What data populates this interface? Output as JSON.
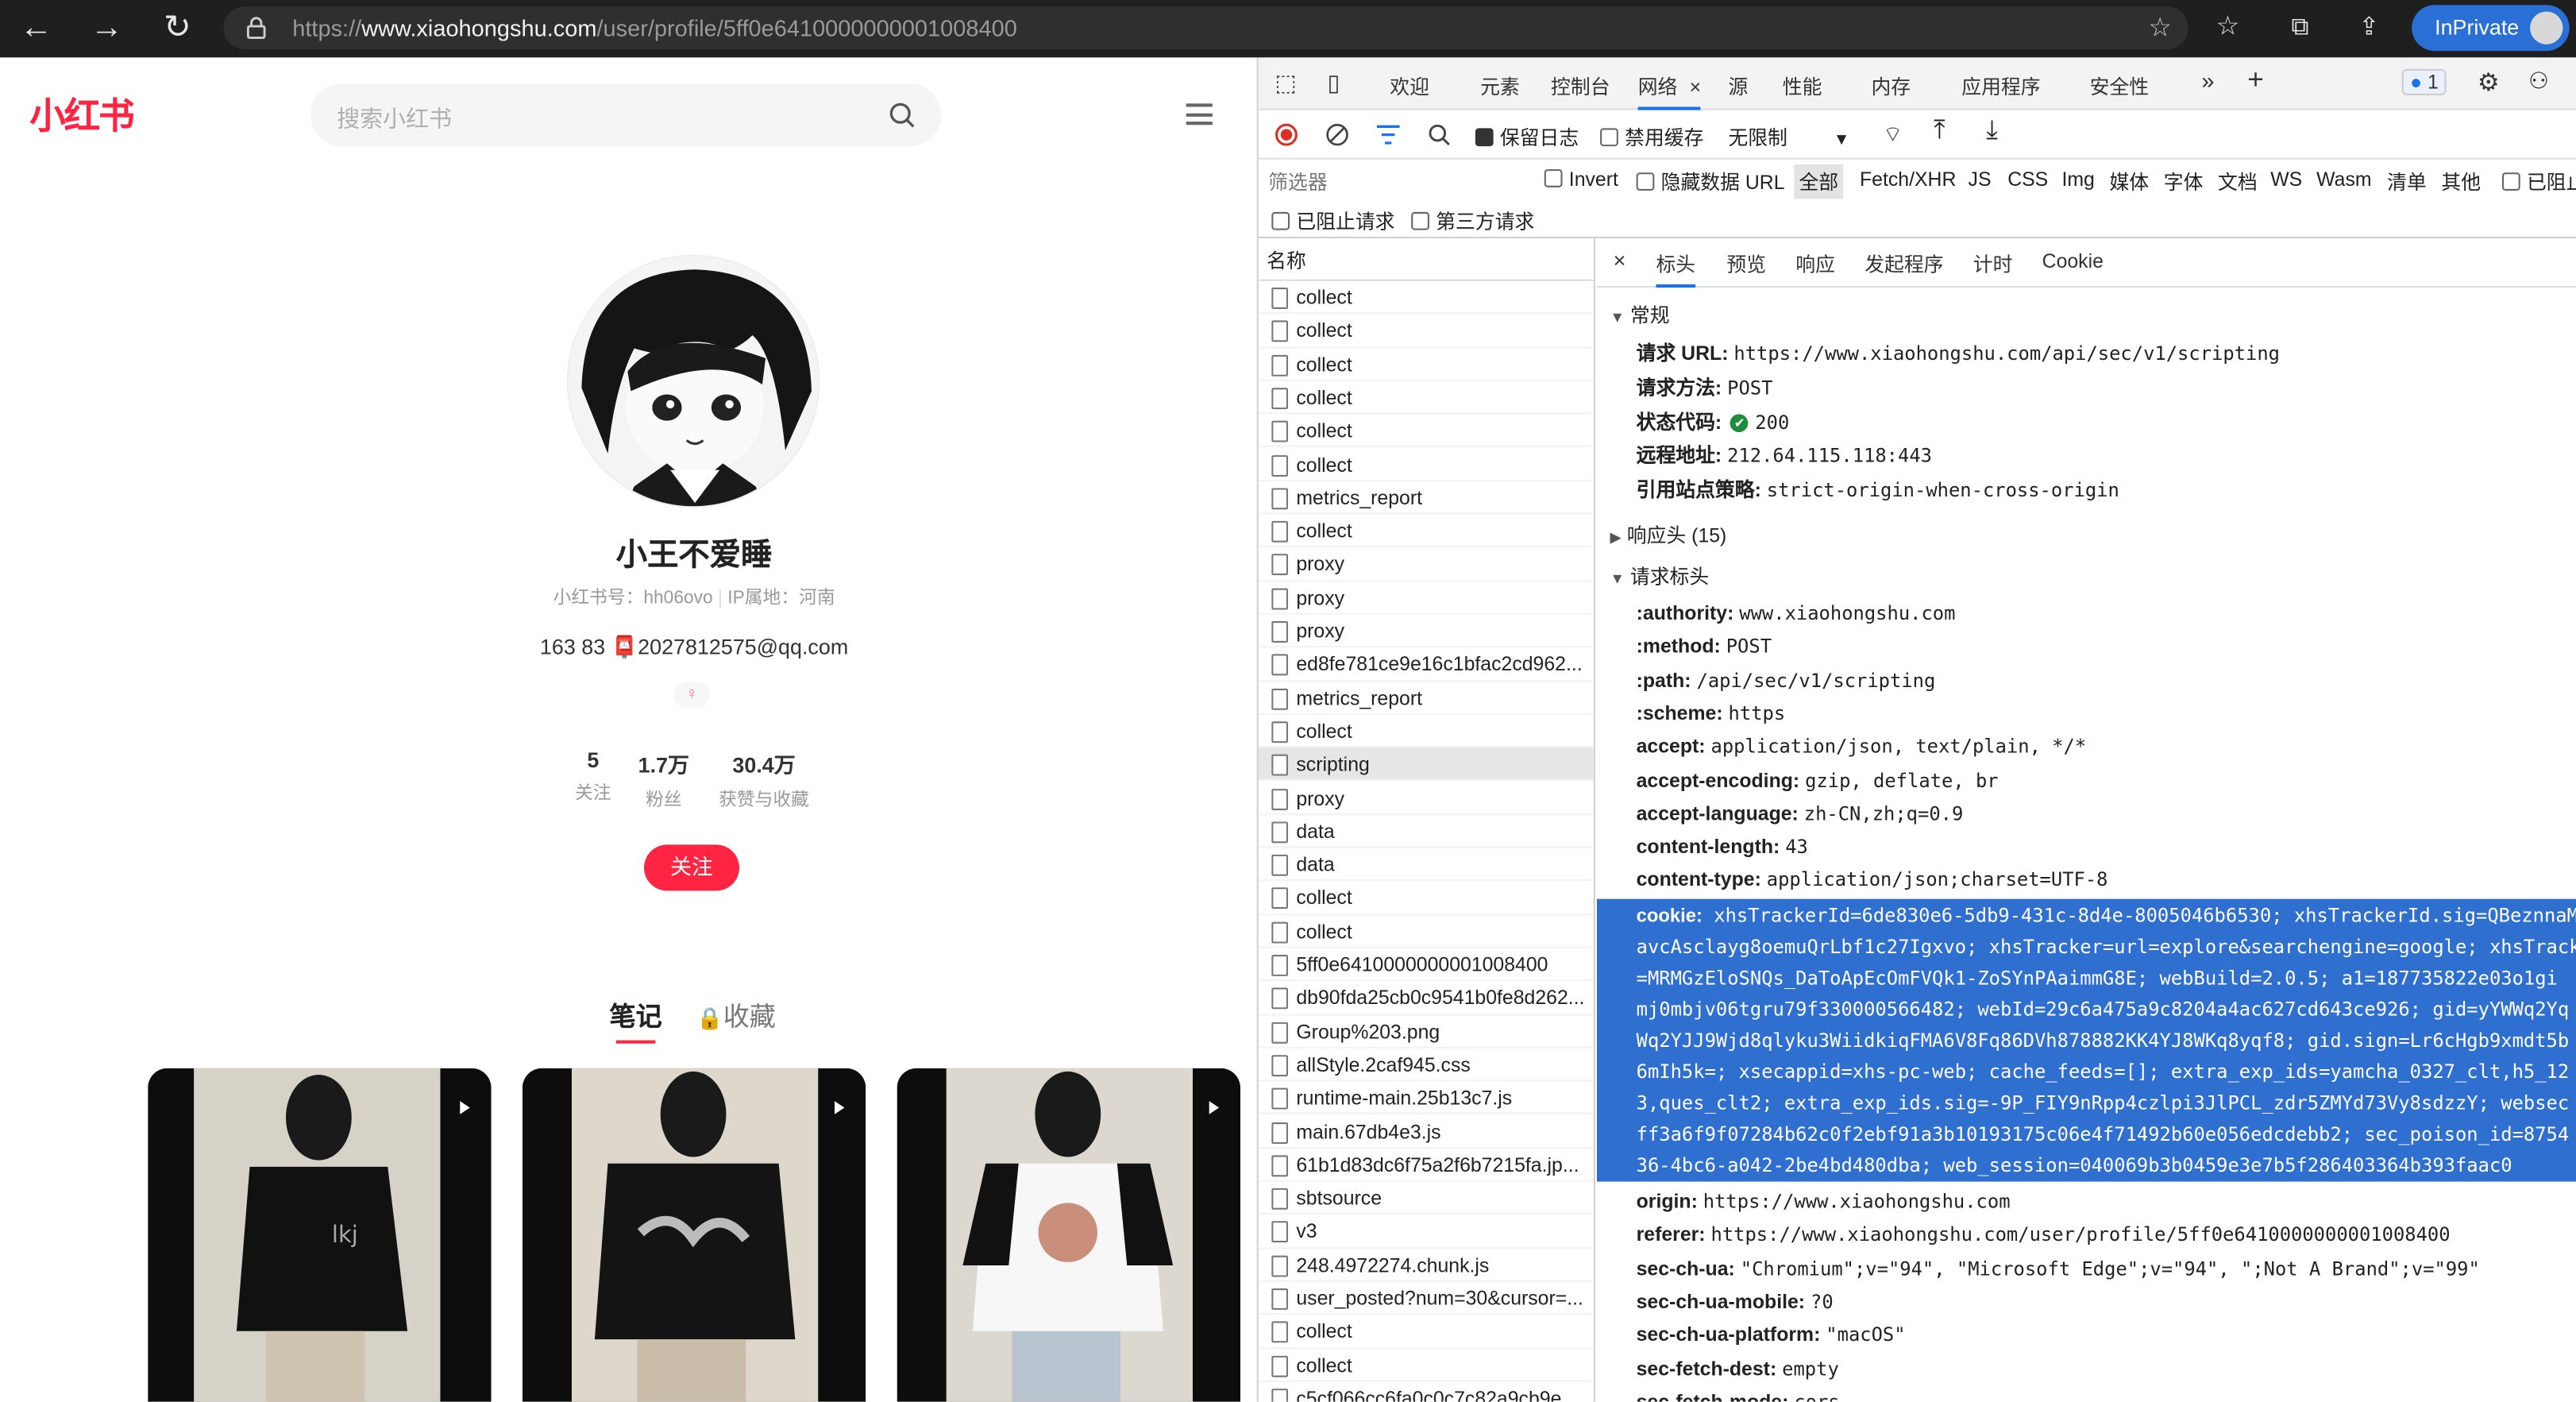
{
  "browser": {
    "url_prefix": "https://",
    "url_host": "www.xiaohongshu.com",
    "url_path": "/user/profile/5ff0e6410000000001008400",
    "inprivate_label": "InPrivate"
  },
  "site": {
    "logo": "小红书",
    "search_placeholder": "搜索小红书"
  },
  "profile": {
    "name": "小王不爱睡",
    "id_line": "小红书号：hh06ovo",
    "ip_line": "IP属地：河南",
    "bio_prefix": "163 83 ",
    "bio_email": "2027812575@qq.com",
    "gender_symbol": "♀",
    "stats": [
      {
        "value": "5",
        "label": "关注"
      },
      {
        "value": "1.7万",
        "label": "粉丝"
      },
      {
        "value": "30.4万",
        "label": "获赞与收藏"
      }
    ],
    "follow_label": "关注",
    "tabs": [
      "笔记",
      "收藏"
    ]
  },
  "devtools": {
    "tabs": [
      "欢迎",
      "元素",
      "控制台",
      "网络",
      "源",
      "性能",
      "内存",
      "应用程序",
      "安全性"
    ],
    "issue_count": "1",
    "toolbar": {
      "preserve_log": "保留日志",
      "disable_cache": "禁用缓存",
      "throttle": "无限制"
    },
    "filter": {
      "placeholder": "筛选器",
      "invert": "Invert",
      "hide_data_urls": "隐藏数据 URL",
      "types": [
        "全部",
        "Fetch/XHR",
        "JS",
        "CSS",
        "Img",
        "媒体",
        "字体",
        "文档",
        "WS",
        "Wasm",
        "清单",
        "其他"
      ],
      "blocked_cookies": "已阻止",
      "blocked_requests": "已阻止请求",
      "third_party": "第三方请求"
    },
    "list_header": "名称",
    "requests": [
      "collect",
      "collect",
      "collect",
      "collect",
      "collect",
      "collect",
      "metrics_report",
      "collect",
      "proxy",
      "proxy",
      "proxy",
      "ed8fe781ce9e16c1bfac2cd962...",
      "metrics_report",
      "collect",
      "scripting",
      "proxy",
      "data",
      "data",
      "collect",
      "collect",
      "5ff0e6410000000001008400",
      "db90fda25cb0c9541b0fe8d262...",
      "Group%203.png",
      "allStyle.2caf945.css",
      "runtime-main.25b13c7.js",
      "main.67db4e3.js",
      "61b1d83dc6f75a2f6b7215fa.jp...",
      "sbtsource",
      "v3",
      "248.4972274.chunk.js",
      "user_posted?num=30&cursor=...",
      "collect",
      "collect",
      "c5cf066cc6fa0c0c7c82a9cb9e..."
    ],
    "detail_tabs": [
      "标头",
      "预览",
      "响应",
      "发起程序",
      "计时",
      "Cookie"
    ],
    "general_title": "常规",
    "general": [
      {
        "k": "请求 URL:",
        "v": "https://www.xiaohongshu.com/api/sec/v1/scripting"
      },
      {
        "k": "请求方法:",
        "v": "POST"
      },
      {
        "k": "状态代码:",
        "v": "200"
      },
      {
        "k": "远程地址:",
        "v": "212.64.115.118:443"
      },
      {
        "k": "引用站点策略:",
        "v": "strict-origin-when-cross-origin"
      }
    ],
    "response_headers_title": "响应头 (15)",
    "request_headers_title": "请求标头",
    "request_headers": [
      {
        "k": ":authority:",
        "v": "www.xiaohongshu.com"
      },
      {
        "k": ":method:",
        "v": "POST"
      },
      {
        "k": ":path:",
        "v": "/api/sec/v1/scripting"
      },
      {
        "k": ":scheme:",
        "v": "https"
      },
      {
        "k": "accept:",
        "v": "application/json, text/plain, */*"
      },
      {
        "k": "accept-encoding:",
        "v": "gzip, deflate, br"
      },
      {
        "k": "accept-language:",
        "v": "zh-CN,zh;q=0.9"
      },
      {
        "k": "content-length:",
        "v": "43"
      },
      {
        "k": "content-type:",
        "v": "application/json;charset=UTF-8"
      }
    ],
    "cookie_key": "cookie:",
    "cookie_lines": [
      "xhsTrackerId=6de830e6-5db9-431c-8d4e-8005046b6530; xhsTrackerId.sig=QBeznnaM",
      "avcAsclayg8oemuQrLbf1c27Igxvo; xhsTracker=url=explore&searchengine=google; xhsTrack",
      "=MRMGzEloSNQs_DaToApEcOmFVQk1-ZoSYnPAaimmG8E; webBuild=2.0.5; a1=187735822e03o1gi",
      "mj0mbjv06tgru79f330000566482; webId=29c6a475a9c8204a4ac627cd643ce926; gid=yYWWq2Yq",
      "Wq2YJJ9Wjd8qlyku3WiidkiqFMA6V8Fq86DVh878882KK4YJ8WKq8yqf8; gid.sign=Lr6cHgb9xmdt5b",
      "6mIh5k=; xsecappid=xhs-pc-web; cache_feeds=[]; extra_exp_ids=yamcha_0327_clt,h5_12",
      "3,ques_clt2; extra_exp_ids.sig=-9P_FIY9nRpp4czlpi3JlPCL_zdr5ZMYd73Vy8sdzzY; websec",
      "ff3a6f9f07284b62c0f2ebf91a3b10193175c06e4f71492b60e056edcdebb2; sec_poison_id=8754",
      "36-4bc6-a042-2be4bd480dba; web_session=040069b3b0459e3e7b5f286403364b393faac0"
    ],
    "after_cookie": [
      {
        "k": "origin:",
        "v": "https://www.xiaohongshu.com"
      },
      {
        "k": "referer:",
        "v": "https://www.xiaohongshu.com/user/profile/5ff0e6410000000001008400"
      },
      {
        "k": "sec-ch-ua:",
        "v": "\"Chromium\";v=\"94\", \"Microsoft Edge\";v=\"94\", \";Not A Brand\";v=\"99\""
      },
      {
        "k": "sec-ch-ua-mobile:",
        "v": "?0"
      },
      {
        "k": "sec-ch-ua-platform:",
        "v": "\"macOS\""
      },
      {
        "k": "sec-fetch-dest:",
        "v": "empty"
      },
      {
        "k": "sec-fetch-mode:",
        "v": "cors"
      }
    ]
  },
  "colors": {
    "brand": "#ff2442",
    "accent": "#2e6fd0",
    "ok": "#1e8e3e"
  }
}
